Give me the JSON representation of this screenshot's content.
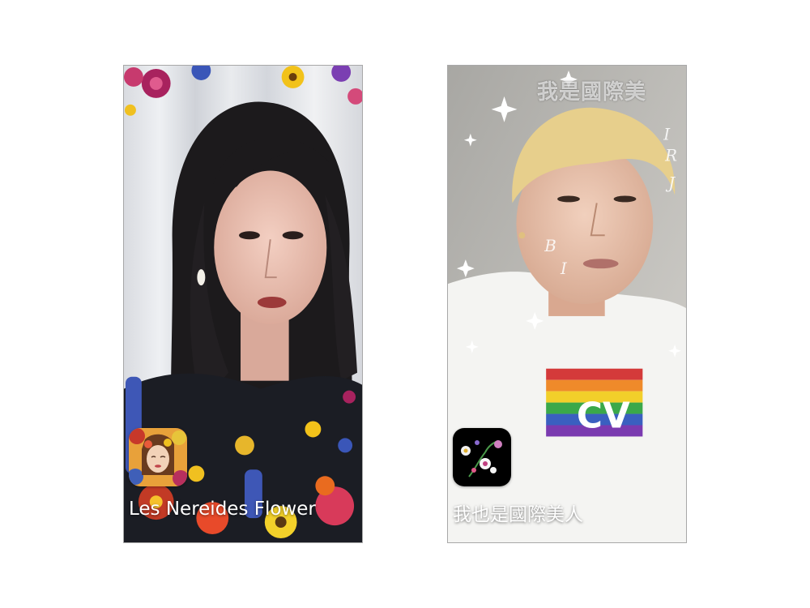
{
  "filters": [
    {
      "id": "left",
      "name": "Les Nereides Flower",
      "icon": "floral-portrait-icon",
      "accent": "#e8a13a"
    },
    {
      "id": "right",
      "name": "我也是國際美人",
      "icon": "flower-sprig-icon",
      "overlay_text": "我是國際美",
      "accent": "#000000"
    }
  ]
}
